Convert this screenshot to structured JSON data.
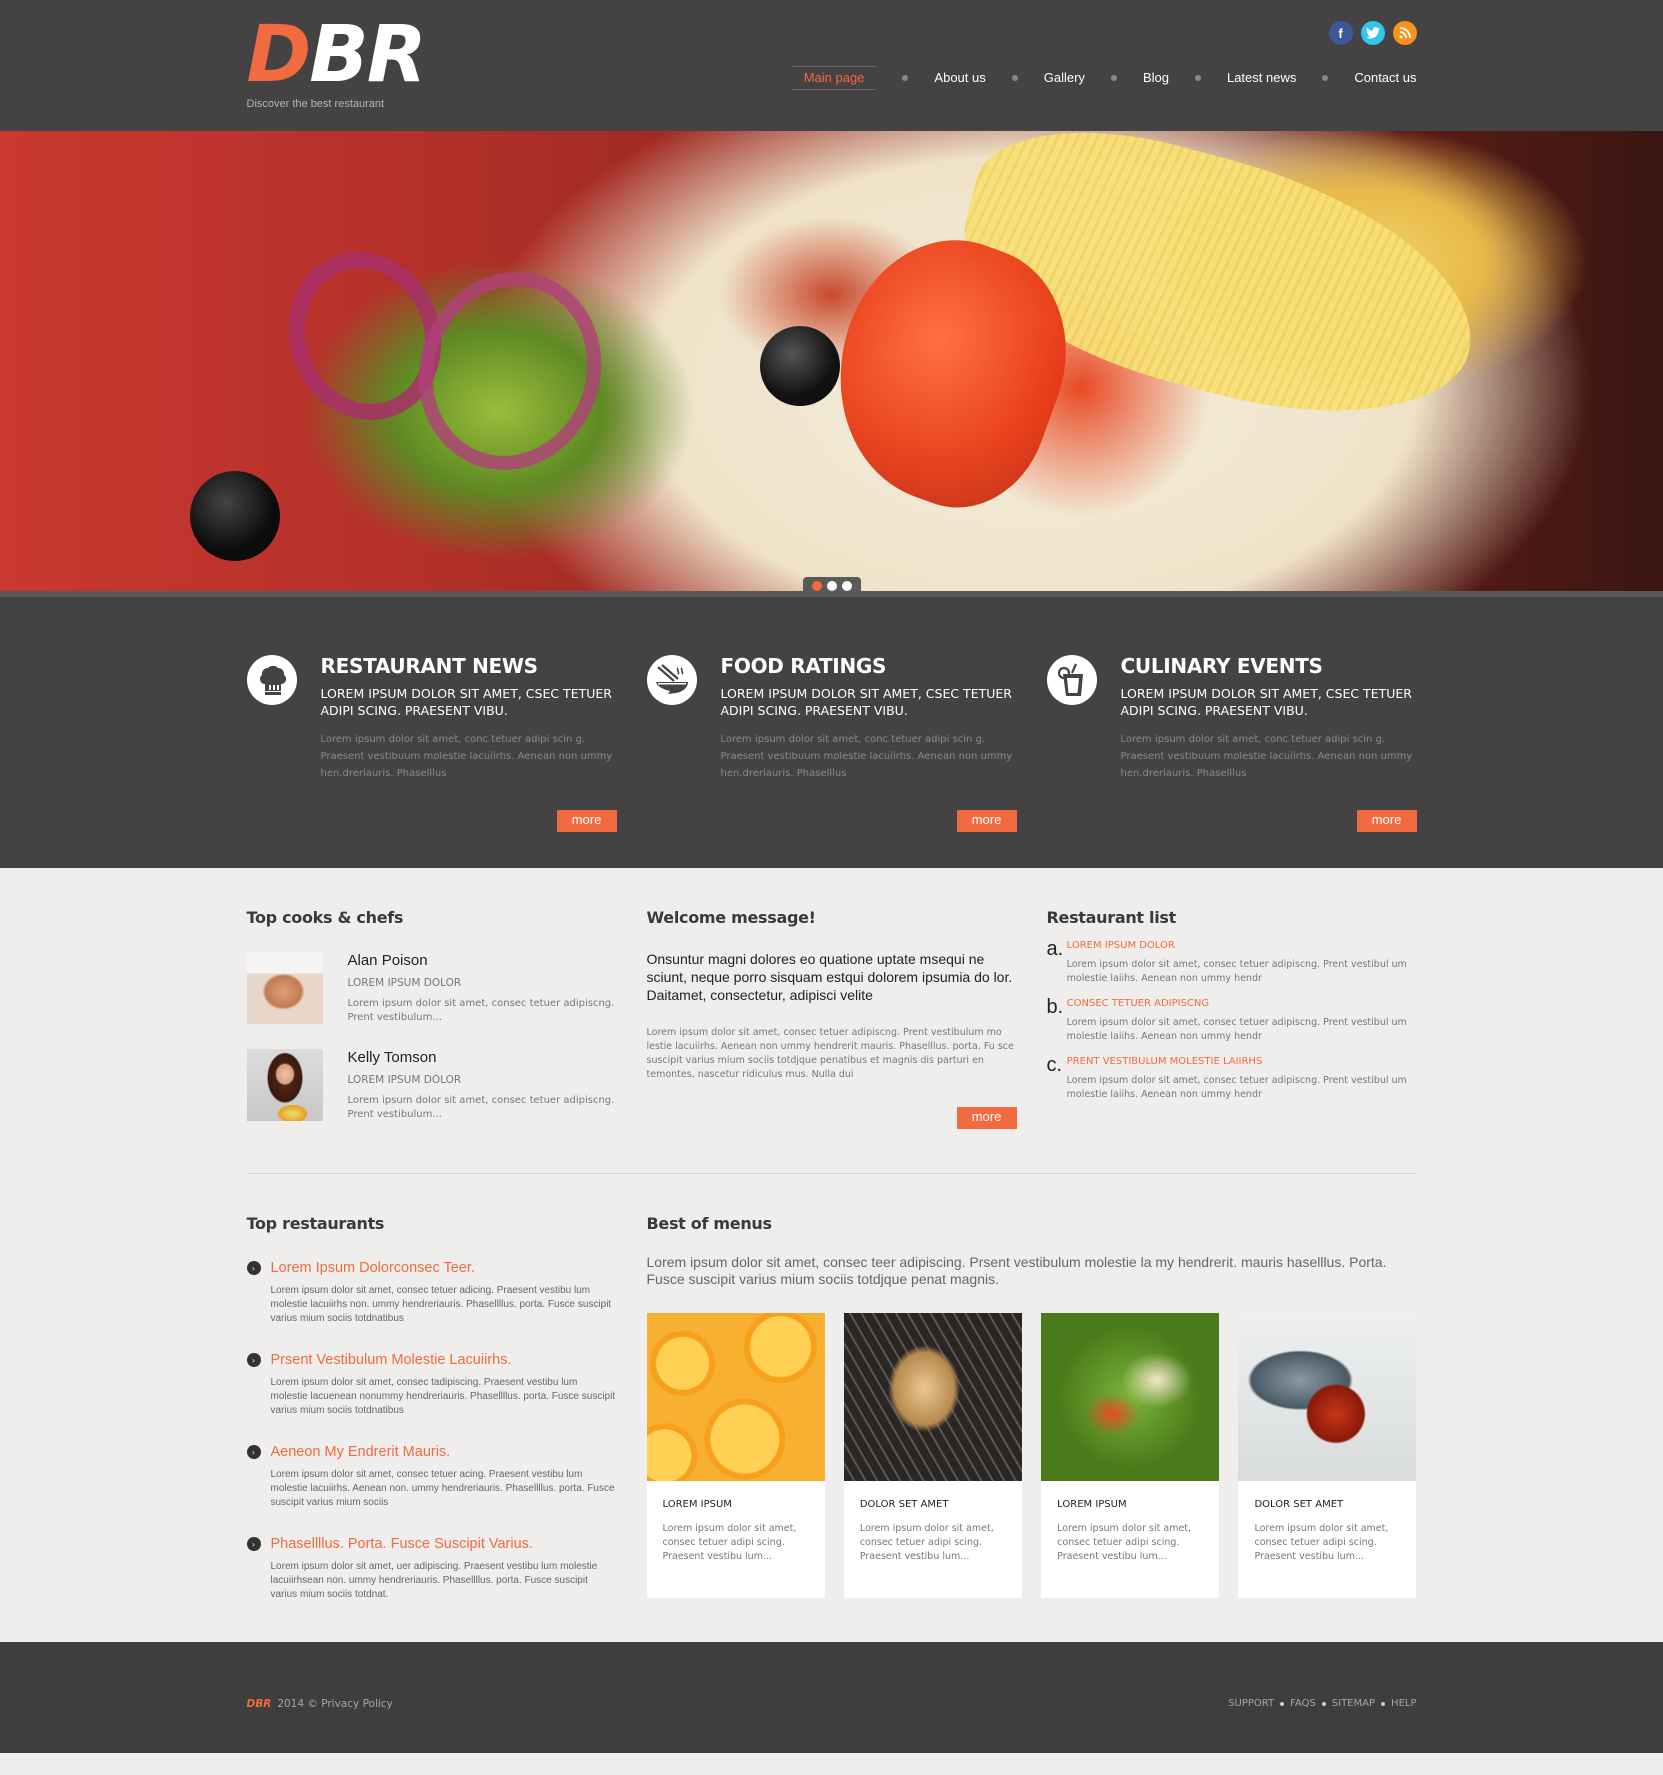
{
  "header": {
    "logo_d": "D",
    "logo_br": "BR",
    "tagline": "Discover the best restaurant",
    "social": [
      {
        "name": "facebook",
        "glyph": "f"
      },
      {
        "name": "twitter",
        "glyph": "t"
      },
      {
        "name": "rss",
        "glyph": "))"
      }
    ],
    "nav": [
      {
        "label": "Main page",
        "active": true
      },
      {
        "label": "About us"
      },
      {
        "label": "Gallery"
      },
      {
        "label": "Blog"
      },
      {
        "label": "Latest news"
      },
      {
        "label": "Contact us"
      }
    ]
  },
  "slider": {
    "slides": 3,
    "active_slide": 1
  },
  "features": [
    {
      "icon": "chef-hat-icon",
      "title": "RESTAURANT NEWS",
      "subtitle": "LOREM IPSUM DOLOR SIT AMET, CSEC TETUER ADIPI SCING. PRAESENT VIBU.",
      "text": "Lorem ipsum dolor sit amet, conc tetuer adipi scin g. Praesent vestibuum molestie lacuiirhs. Aenean non ummy hen.dreriauris. Phaselllus",
      "button": "more"
    },
    {
      "icon": "bowl-chopsticks-icon",
      "title": "FOOD RATINGS",
      "subtitle": "LOREM IPSUM DOLOR SIT AMET, CSEC TETUER ADIPI SCING. PRAESENT VIBU.",
      "text": "Lorem ipsum dolor sit amet, conc tetuer adipi scin g. Praesent vestibuum molestie lacuiirhs. Aenean non ummy hen.dreriauris. Phaselllus",
      "button": "more"
    },
    {
      "icon": "drink-glass-icon",
      "title": "CULINARY EVENTS",
      "subtitle": "LOREM IPSUM DOLOR SIT AMET, CSEC TETUER ADIPI SCING. PRAESENT VIBU.",
      "text": "Lorem ipsum dolor sit amet, conc tetuer adipi scin g. Praesent vestibuum molestie lacuiirhs. Aenean non ummy hen.dreriauris. Phaselllus",
      "button": "more"
    }
  ],
  "chefs": {
    "title": "Top cooks & chefs",
    "items": [
      {
        "name": "Alan Poison",
        "role": "LOREM IPSUM DOLOR",
        "text": "Lorem ipsum dolor sit amet, consec tetuer adipiscng. Prent vestibulum..."
      },
      {
        "name": "Kelly Tomson",
        "role": "LOREM IPSUM DOLOR",
        "text": "Lorem ipsum dolor sit amet, consec tetuer adipiscng. Prent vestibulum..."
      }
    ]
  },
  "welcome": {
    "title": "Welcome message!",
    "lead": "Onsuntur magni dolores eo quatione uptate msequi ne sciunt, neque porro sisquam estqui dolorem ipsumia do lor. Daitamet, consectetur, adipisci velite",
    "text": "Lorem ipsum dolor sit amet, consec tetuer adipiscng. Prent vestibulum mo lestie lacuiirhs. Aenean non ummy hendrerit mauris. Phaselllus. porta. Fu sce suscipit varius mium sociis totdjque penatibus et magnis dis parturi en temontes, nascetur ridiculus mus. Nulla dui",
    "button": "more"
  },
  "restaurant_list": {
    "title": "Restaurant list",
    "items": [
      {
        "letter": "a.",
        "title": "LOREM IPSUM DOLOR",
        "text": "Lorem ipsum dolor sit amet, consec tetuer adipiscng. Prent vestibul um molestie laiihs. Aenean non ummy hendr"
      },
      {
        "letter": "b.",
        "title": "CONSEC TETUER ADIPISCNG",
        "text": "Lorem ipsum dolor sit amet, consec tetuer adipiscng. Prent vestibul um molestie laiihs. Aenean non ummy hendr"
      },
      {
        "letter": "c.",
        "title": "PRENT VESTIBULUM MOLESTIE LAIIRHS",
        "text": "Lorem ipsum dolor sit amet, consec tetuer adipiscng. Prent vestibul um molestie laiihs. Aenean non ummy hendr"
      }
    ]
  },
  "top_restaurants": {
    "title": "Top restaurants",
    "items": [
      {
        "title": "Lorem Ipsum Dolorconsec Teer.",
        "text": "Lorem ipsum dolor sit amet, consec tetuer adicing. Praesent vestibu lum molestie lacuiirhs non. ummy hendreriauris. Phasellllus. porta. Fusce suscipit varius mium sociis totdnatibus"
      },
      {
        "title": "Prsent Vestibulum Molestie Lacuiirhs.",
        "text": "Lorem ipsum dolor sit amet, consec tadipiscing. Praesent vestibu lum molestie lacuenean nonummy hendreriauris. Phasellllus. porta. Fusce suscipit varius mium sociis totdnatibus"
      },
      {
        "title": "Aeneon My  Endrerit Mauris.",
        "text": "Lorem ipsum dolor sit amet, consec tetuer acing. Praesent vestibu lum molestie lacuiirhs. Aenean non. ummy hendreriauris. Phasellllus. porta. Fusce suscipit varius mium sociis"
      },
      {
        "title": "Phasellllus. Porta. Fusce Suscipit Varius.",
        "text": "Lorem ipsum dolor sit amet, uer adipiscing. Praesent vestibu lum molestie lacuiirhsean non.  ummy hendreriauris. Phasellllus. porta. Fusce suscipit varius mium sociis totdnat."
      }
    ]
  },
  "menus": {
    "title": "Best of menus",
    "intro": "Lorem ipsum dolor sit amet, consec teer adipiscing. Prsent vestibulum molestie la my hendrerit. mauris haselllus. Porta. Fusce suscipit varius mium sociis totdjque penat magnis.",
    "items": [
      {
        "image": "oranges",
        "title": "LOREM IPSUM",
        "text": "Lorem ipsum dolor sit amet, consec tetuer adipi scing. Praesent vestibu lum..."
      },
      {
        "image": "grilled-fish",
        "title": "DOLOR SET AMET",
        "text": "Lorem ipsum dolor sit amet, consec tetuer adipi scing. Praesent vestibu lum..."
      },
      {
        "image": "salad",
        "title": "LOREM IPSUM",
        "text": "Lorem ipsum dolor sit amet, consec tetuer adipi scing. Praesent vestibu lum..."
      },
      {
        "image": "seafood",
        "title": "DOLOR SET AMET",
        "text": "Lorem ipsum dolor sit amet, consec tetuer adipi scing. Praesent vestibu lum..."
      }
    ]
  },
  "footer": {
    "logo": "DBR",
    "copyright": "2014 © Privacy Policy",
    "links": [
      "SUPPORT",
      "FAQS",
      "SITEMAP",
      "HELP"
    ]
  },
  "colors": {
    "accent": "#f26a3f",
    "dark_bg": "#444242",
    "light_bg": "#efeeec",
    "footer_bg": "#3e3e3e"
  }
}
